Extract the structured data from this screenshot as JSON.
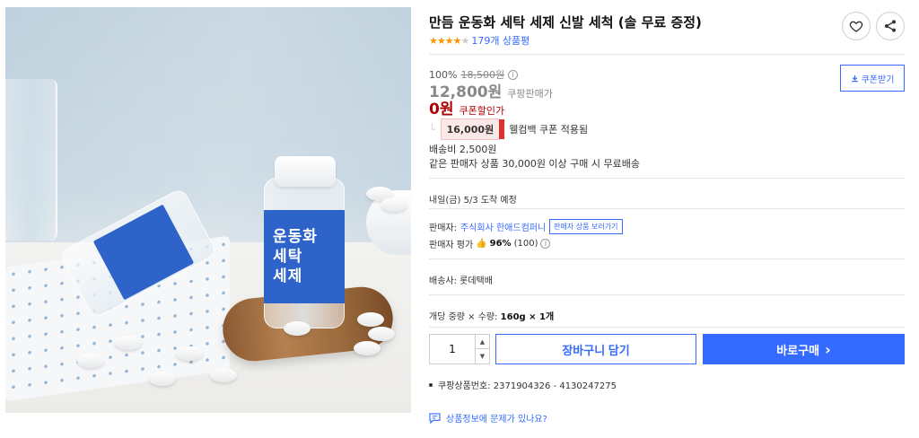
{
  "product": {
    "title": "만듬 운동화 세탁 세제 신발 세척 (솔 무료 증정)",
    "rating_stars_filled": "★★★★",
    "rating_stars_empty": "★",
    "review_count": "179개 상품평",
    "jar_label_lines": [
      "운동화",
      "세탁",
      "세제"
    ]
  },
  "price": {
    "discount_rate": "100%",
    "original_price": "18,500원",
    "info_glyph": "i",
    "sale_price": "12,800원",
    "sale_label": "쿠팡판매가",
    "coupon_price": "0원",
    "coupon_label": "쿠폰할인가",
    "coupon_button": "쿠폰받기",
    "cashback_corner": "└",
    "cashback_amount": "16,000원",
    "cashback_text": "웰컴백 쿠폰 적용됨"
  },
  "shipping": {
    "fee": "배송비 2,500원",
    "free_condition": "같은 판매자 상품 30,000원 이상 구매 시 무료배송",
    "arrival": "내일(금) 5/3 도착 예정",
    "courier": "배송사: 롯데택배"
  },
  "seller": {
    "label": "판매자:",
    "name": "주식회사 한애드컴퍼니",
    "more_button": "판매자 상품 보러가기",
    "eval_label": "판매자 평가",
    "eval_icon": "👍",
    "eval_score": "96%",
    "eval_count": "(100)"
  },
  "option": {
    "label": "개당 중량 × 수량:",
    "value": "160g × 1개"
  },
  "purchase": {
    "quantity": "1",
    "qty_up": "▲",
    "qty_down": "▼",
    "cart_button": "장바구니 담기",
    "buy_button": "바로구매",
    "buy_arrow": "›"
  },
  "meta": {
    "product_number": "쿠팡상품번호: 2371904326 - 4130247275",
    "report_link": "상품정보에 문제가 있나요?"
  },
  "colors": {
    "accent": "#346aff",
    "coupon_red": "#ae0000",
    "star": "#ff9600"
  },
  "icons": {
    "heart": "heart-icon",
    "share": "share-icon",
    "download": "download-icon",
    "report": "chat-report-icon"
  }
}
